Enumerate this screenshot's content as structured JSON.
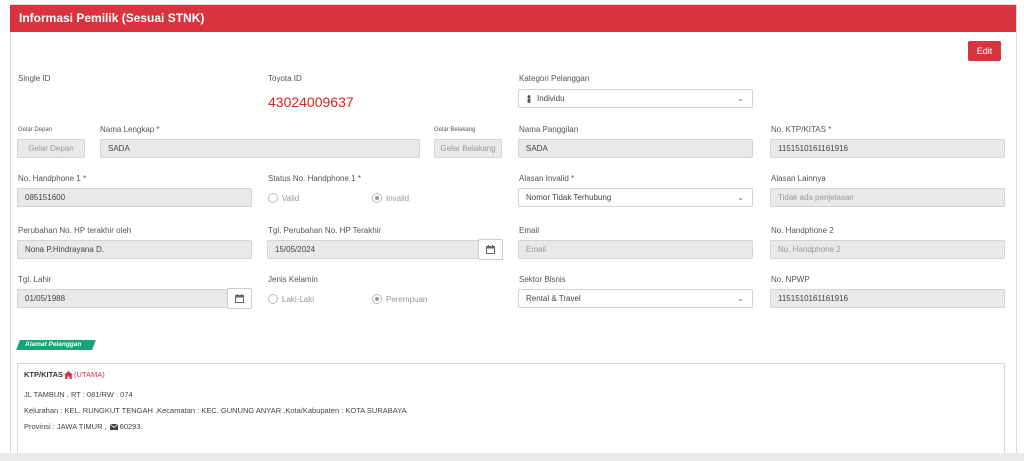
{
  "header": {
    "title": "Informasi Pemilik (Sesuai STNK)"
  },
  "edit_label": "Edit",
  "fields": {
    "single_id": {
      "label": "Single ID"
    },
    "toyota_id": {
      "label": "Toyota ID",
      "value": "43024009637"
    },
    "kategori": {
      "label": "Kategori Pelanggan",
      "value": "Individu"
    },
    "gelar_depan": {
      "label": "Gelar Depan",
      "placeholder": "Gelar Depan"
    },
    "nama_lengkap": {
      "label": "Nama Lengkap *",
      "value": "SADA"
    },
    "gelar_belakang": {
      "label": "Gelar Belakang",
      "placeholder": "Gelar Belakang"
    },
    "nama_panggilan": {
      "label": "Nama Panggilan",
      "value": "SADA"
    },
    "ktp": {
      "label": "No. KTP/KITAS *",
      "value": "1151510161161916"
    },
    "hp1": {
      "label": "No. Handphone 1 *",
      "value": "085151600"
    },
    "status_hp1": {
      "label": "Status No. Handphone 1 *",
      "options": [
        "Valid",
        "Invalid"
      ],
      "selected": "Invalid"
    },
    "alasan_invalid": {
      "label": "Alasan Invalid *",
      "value": "Nomor Tidak Terhubung"
    },
    "alasan_lainnya": {
      "label": "Alasan Lainnya",
      "placeholder": "Tidak ada penjelasan"
    },
    "perubahan_oleh": {
      "label": "Perubahan No. HP terakhir oleh",
      "value": "Nona P.Hindrayana D."
    },
    "tgl_perubahan": {
      "label": "Tgl. Perubahan No. HP Terakhir",
      "value": "15/05/2024"
    },
    "email": {
      "label": "Email",
      "placeholder": "Email"
    },
    "hp2": {
      "label": "No. Handphone 2",
      "placeholder": "No. Handphone 2"
    },
    "tgl_lahir": {
      "label": "Tgl. Lahir",
      "value": "01/05/1988"
    },
    "jenis_kelamin": {
      "label": "Jenis Kelamin",
      "options": [
        "Laki-Laki",
        "Perempuan"
      ],
      "selected": "Perempuan"
    },
    "sektor": {
      "label": "Sektor Bisnis",
      "value": "Rental & Travel"
    },
    "npwp": {
      "label": "No. NPWP",
      "value": "1151510161161916"
    }
  },
  "alamat": {
    "tag": "Alamat Pelanggan",
    "type": "KTP/KITAS",
    "utama": "(UTAMA)",
    "line1": "JL TAMBUN , RT : 081/RW : 074",
    "line2": "Kelurahan : KEL. RUNGKUT TENGAH ,Kecamatan : KEC. GUNUNG ANYAR ,Kota/Kabupaten : KOTA SURABAYA",
    "line3_prefix": "Provinsi : JAWA TIMUR ,",
    "line3_postal": "60293."
  },
  "colors": {
    "brand_red": "#d9333f",
    "accent_green": "#17a673",
    "id_red": "#e02020"
  }
}
